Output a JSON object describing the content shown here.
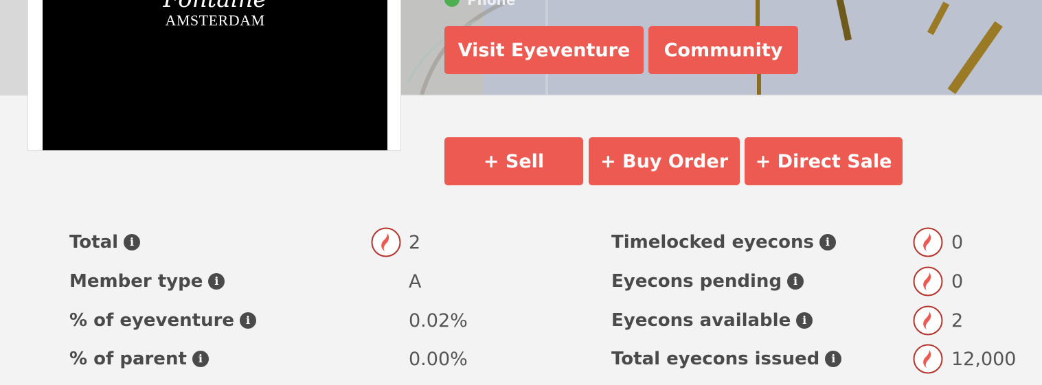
{
  "header": {
    "logo_script": "Fontaine",
    "logo_city": "AMSTERDAM",
    "phone_label": "Phone",
    "links": [
      {
        "label": "Visit Eyeventure"
      },
      {
        "label": "Community"
      }
    ]
  },
  "actions": [
    {
      "label": "+ Sell"
    },
    {
      "label": "+ Buy Order"
    },
    {
      "label": "+ Direct Sale"
    }
  ],
  "stats_left": [
    {
      "label": "Total",
      "value": "2",
      "coin": true
    },
    {
      "label": "Member type",
      "value": "A",
      "coin": false
    },
    {
      "label": "% of eyeventure",
      "value": "0.02%",
      "coin": false
    },
    {
      "label": "% of parent",
      "value": "0.00%",
      "coin": false
    }
  ],
  "stats_right": [
    {
      "label": "Timelocked eyecons",
      "value": "0",
      "coin": true
    },
    {
      "label": "Eyecons pending",
      "value": "0",
      "coin": true
    },
    {
      "label": "Eyecons available",
      "value": "2",
      "coin": true
    },
    {
      "label": "Total eyecons issued",
      "value": "12,000",
      "coin": true
    }
  ],
  "icons": {
    "info": "info-icon",
    "coin": "eyecon-coin-icon",
    "phone_status": "check-circle-icon"
  },
  "colors": {
    "accent": "#ec5a52",
    "background": "#f3f3f3",
    "label": "#4a4a4a",
    "coin_ring": "#b5332b"
  }
}
